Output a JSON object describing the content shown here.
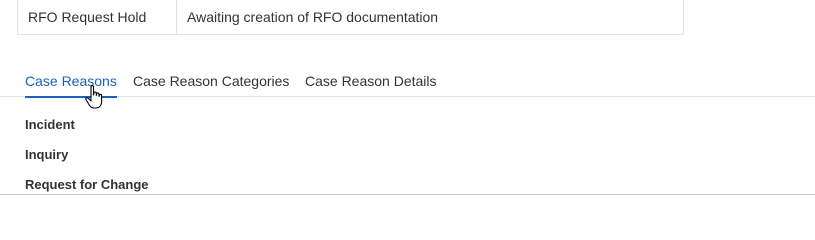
{
  "status_row": {
    "name": "RFO Request Hold",
    "description": "Awaiting creation of RFO documentation"
  },
  "tabs": [
    {
      "label": "Case Reasons",
      "active": true
    },
    {
      "label": "Case Reason Categories",
      "active": false
    },
    {
      "label": "Case Reason Details",
      "active": false
    }
  ],
  "reasons": [
    {
      "label": "Incident"
    },
    {
      "label": "Inquiry"
    },
    {
      "label": "Request for Change"
    }
  ],
  "colors": {
    "accent": "#1565c0",
    "text": "#333333",
    "border": "#e3e3e3"
  },
  "icons": {
    "cursor": "hand-pointer-icon"
  }
}
